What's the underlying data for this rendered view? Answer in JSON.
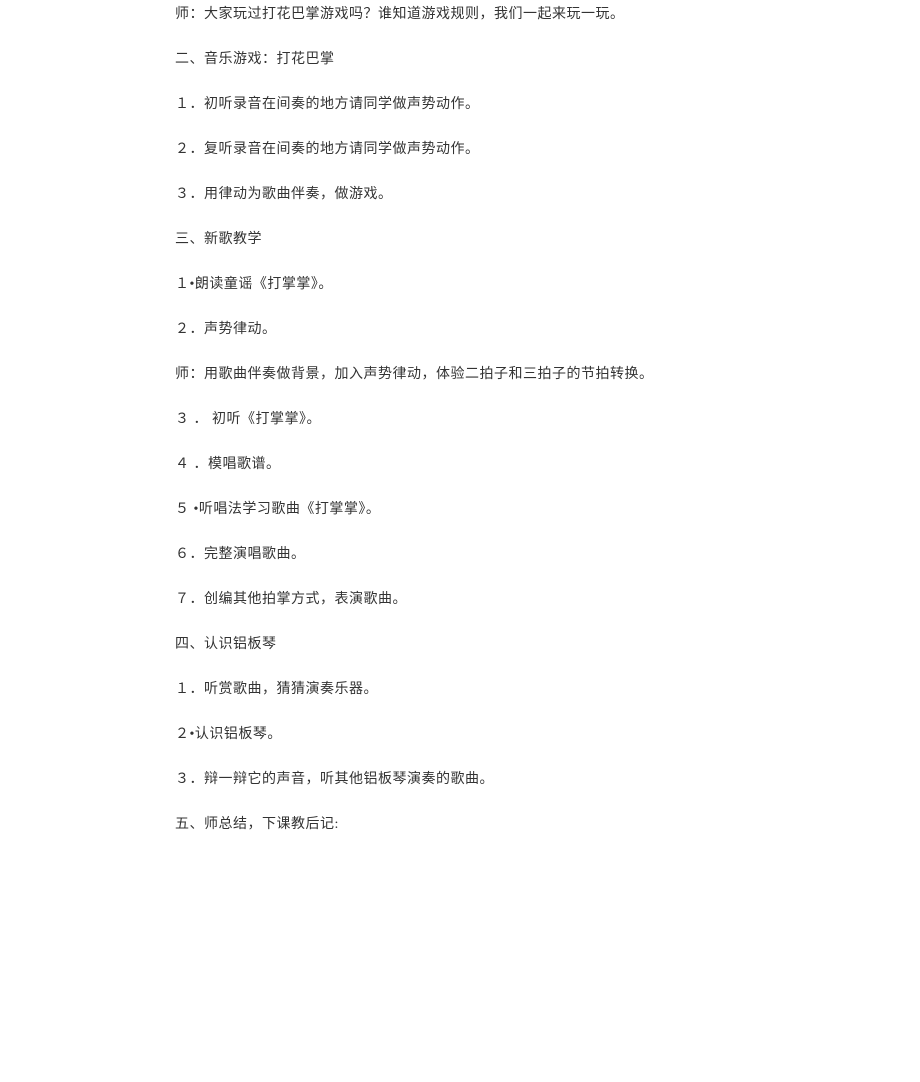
{
  "paragraphs": [
    "师：大家玩过打花巴掌游戏吗？谁知道游戏规则，我们一起来玩一玩。",
    "二、音乐游戏：打花巴掌",
    "１．初听录音在间奏的地方请同学做声势动作。",
    "２．复听录音在间奏的地方请同学做声势动作。",
    "３．用律动为歌曲伴奏，做游戏。",
    "三、新歌教学",
    "１•朗读童谣《打掌掌》。",
    "２．声势律动。",
    "师：用歌曲伴奏做背景，加入声势律动，体验二拍子和三拍子的节拍转换。",
    "３ ． 初听《打掌掌》。",
    "４ ．模唱歌谱。",
    "５ •听唱法学习歌曲《打掌掌》。",
    "６．完整演唱歌曲。",
    "７．创编其他拍掌方式，表演歌曲。",
    "四、认识铝板琴",
    "１．听赏歌曲，猜猜演奏乐器。",
    "２•认识铝板琴。",
    "３．辩一辩它的声音，听其他铝板琴演奏的歌曲。",
    "五、师总结，下课教后记:"
  ]
}
